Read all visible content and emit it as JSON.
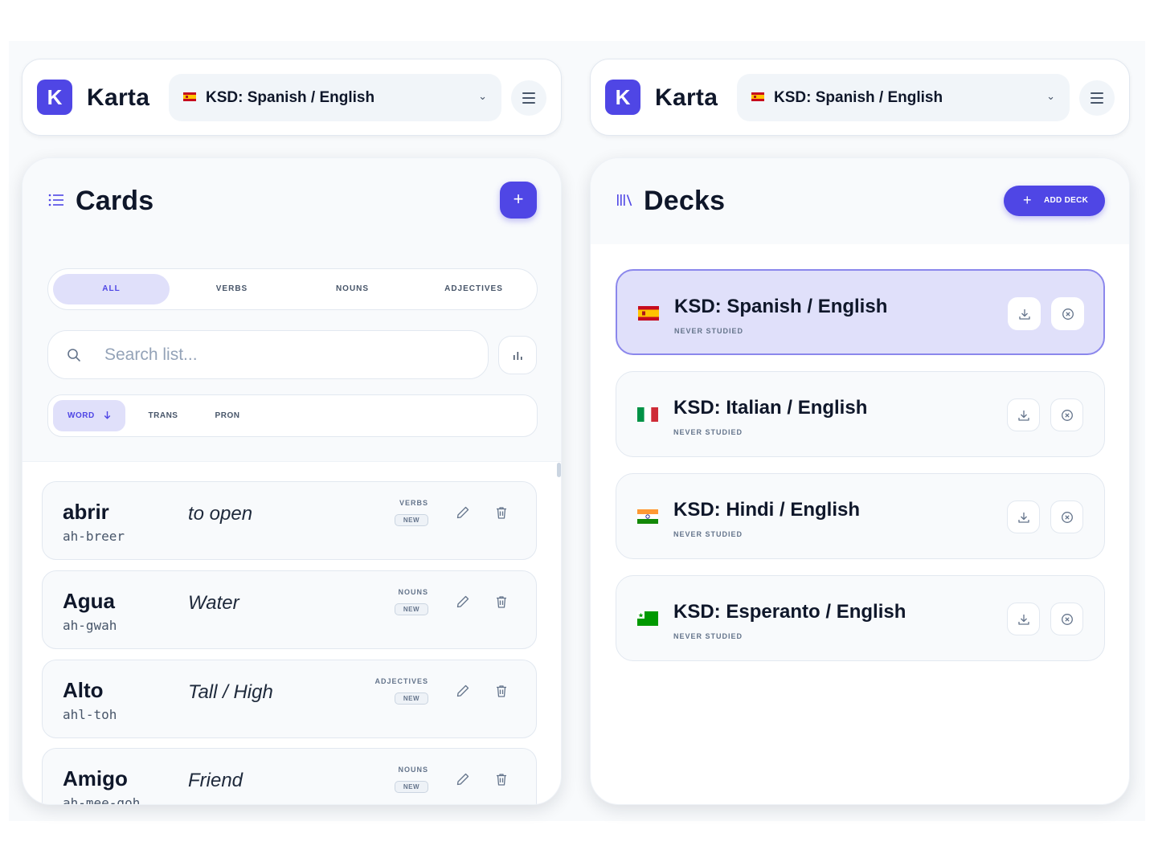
{
  "app": {
    "logo_letter": "K",
    "name": "Karta"
  },
  "deck_selector": {
    "selected": "KSD: Spanish / English"
  },
  "cards_panel": {
    "title": "Cards",
    "filters": [
      "ALL",
      "VERBS",
      "NOUNS",
      "ADJECTIVES"
    ],
    "active_filter": "ALL",
    "search": {
      "placeholder": "Search list..."
    },
    "sort": {
      "options": [
        "WORD",
        "TRANS",
        "PRON"
      ],
      "active": "WORD",
      "direction": "descending-arrow"
    },
    "cards": [
      {
        "word": "abrir",
        "pron": "ah-breer",
        "trans": "to open",
        "category": "VERBS",
        "badge": "NEW"
      },
      {
        "word": "Agua",
        "pron": "ah-gwah",
        "trans": "Water",
        "category": "NOUNS",
        "badge": "NEW"
      },
      {
        "word": "Alto",
        "pron": "ahl-toh",
        "trans": "Tall / High",
        "category": "ADJECTIVES",
        "badge": "NEW"
      },
      {
        "word": "Amigo",
        "pron": "ah-mee-goh",
        "trans": "Friend",
        "category": "NOUNS",
        "badge": "NEW"
      }
    ]
  },
  "decks_panel": {
    "title": "Decks",
    "add_label": "ADD DECK",
    "decks": [
      {
        "name": "KSD: Spanish / English",
        "status": "NEVER STUDIED",
        "flag": "spain",
        "active": true
      },
      {
        "name": "KSD: Italian / English",
        "status": "NEVER STUDIED",
        "flag": "italy",
        "active": false
      },
      {
        "name": "KSD: Hindi / English",
        "status": "NEVER STUDIED",
        "flag": "india",
        "active": false
      },
      {
        "name": "KSD: Esperanto / English",
        "status": "NEVER STUDIED",
        "flag": "esperanto",
        "active": false
      }
    ]
  },
  "colors": {
    "accent": "#4f46e5",
    "accent_soft": "#e0e0fa",
    "text": "#0f172a",
    "muted": "#64748b"
  }
}
